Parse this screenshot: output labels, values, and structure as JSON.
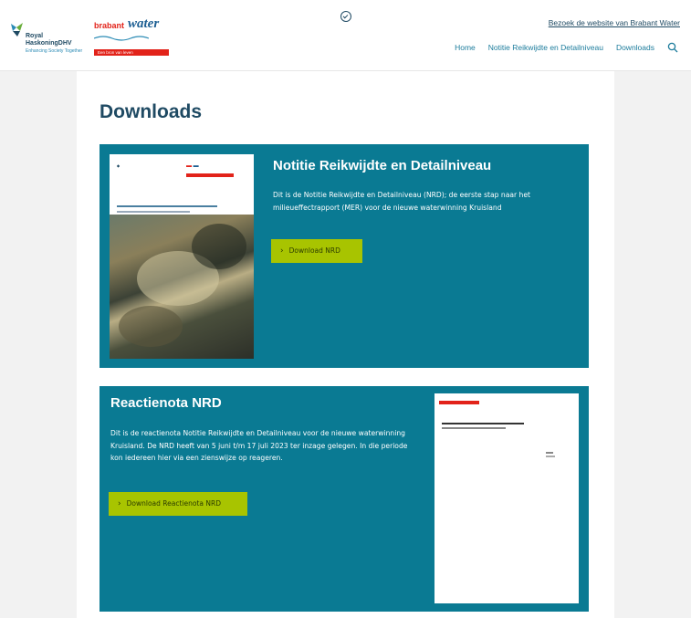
{
  "header": {
    "logo_left": {
      "line1": "Royal",
      "line2": "HaskoningDHV",
      "tagline": "Enhancing Society Together"
    },
    "logo_right": {
      "brabant": "brabant",
      "water": "water",
      "tagline": "Een bron van leven"
    },
    "visit_link": "Bezoek de website van Brabant Water",
    "nav": [
      "Home",
      "Notitie Reikwijdte en Detailniveau",
      "Downloads"
    ],
    "icons": {
      "search": "search-icon",
      "badge": "check-circle-icon"
    }
  },
  "page": {
    "title": "Downloads"
  },
  "downloads": [
    {
      "title": "Notitie Reikwijdte en Detailniveau",
      "description": "Dit is de Notitie Reikwijdte en Detailniveau (NRD); de eerste stap naar het milieueffectrapport (MER) voor de nieuwe waterwinning Kruisland",
      "button": "Download NRD"
    },
    {
      "title": "Reactienota NRD",
      "description": "Dit is de reactienota Notitie Reikwijdte en Detailniveau voor de nieuwe waterwinning Kruisland. De NRD heeft van 5 juni t/m 17 juli 2023 ter inzage gelegen. In die periode kon iedereen hier via een zienswijze op reageren.",
      "button": "Download Reactienota NRD"
    }
  ],
  "colors": {
    "block": "#0a7a93",
    "button": "#a8c400",
    "title": "#1f4a63",
    "brand_red": "#e2231a"
  }
}
